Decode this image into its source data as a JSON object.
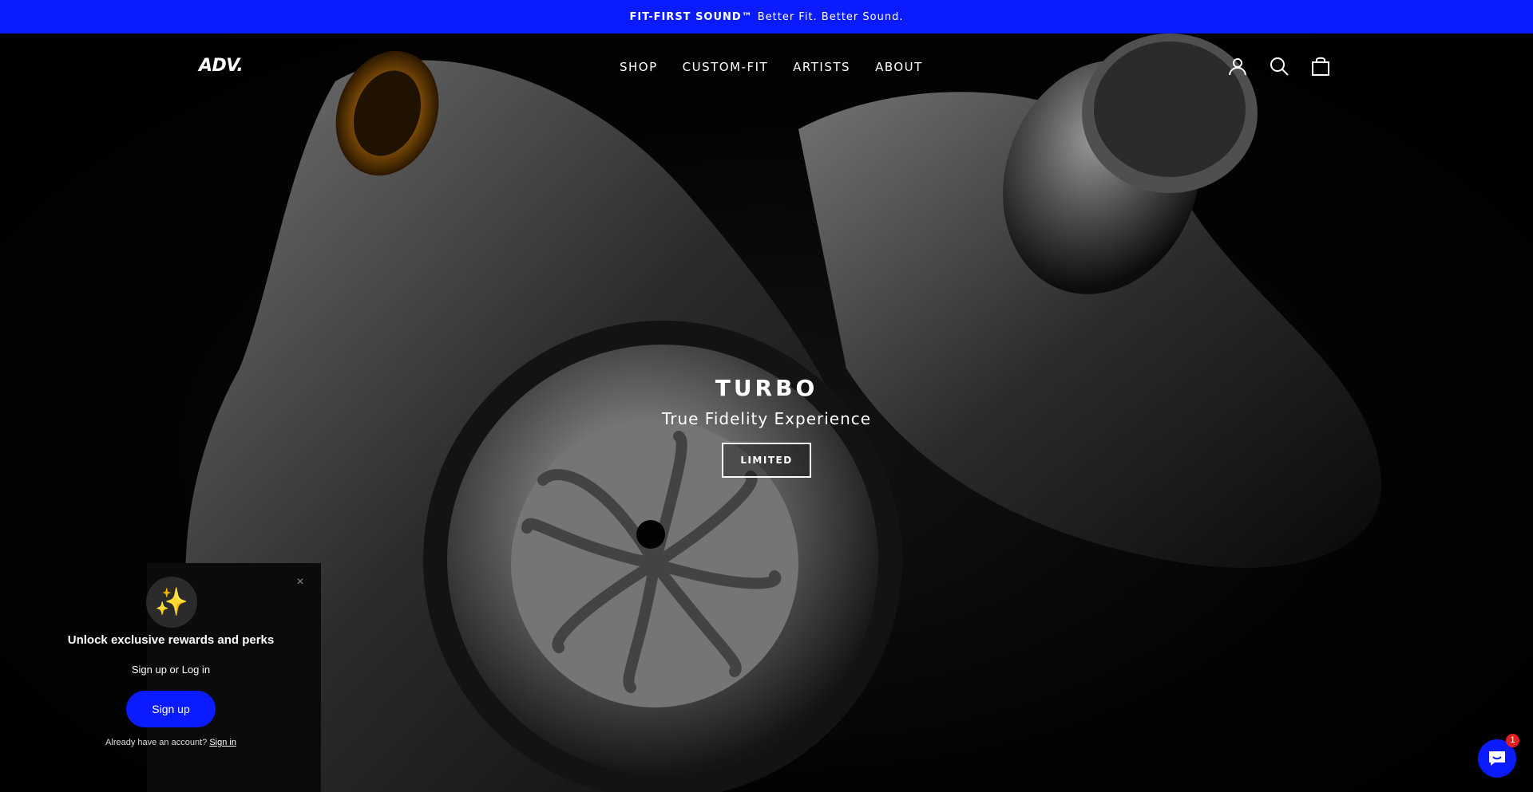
{
  "announcement": {
    "bold": "FIT-FIRST SOUND™",
    "text": "Better Fit. Better Sound."
  },
  "header": {
    "logo": "ADV.",
    "nav": [
      "SHOP",
      "CUSTOM-FIT",
      "ARTISTS",
      "ABOUT"
    ],
    "icons": [
      "account-icon",
      "search-icon",
      "cart-icon"
    ]
  },
  "hero": {
    "title": "TURBO",
    "subtitle": "True Fidelity Experience",
    "button": "LIMITED"
  },
  "popup": {
    "icon": "✨",
    "title": "Unlock exclusive rewards and perks",
    "line": "Sign up or Log in",
    "button": "Sign up",
    "footer_prefix": "Already have an account?",
    "footer_link": "Sign in",
    "close": "×"
  },
  "chat": {
    "badge": "1"
  },
  "colors": {
    "brand_blue": "#0a1bff",
    "badge_red": "#e0201e"
  }
}
